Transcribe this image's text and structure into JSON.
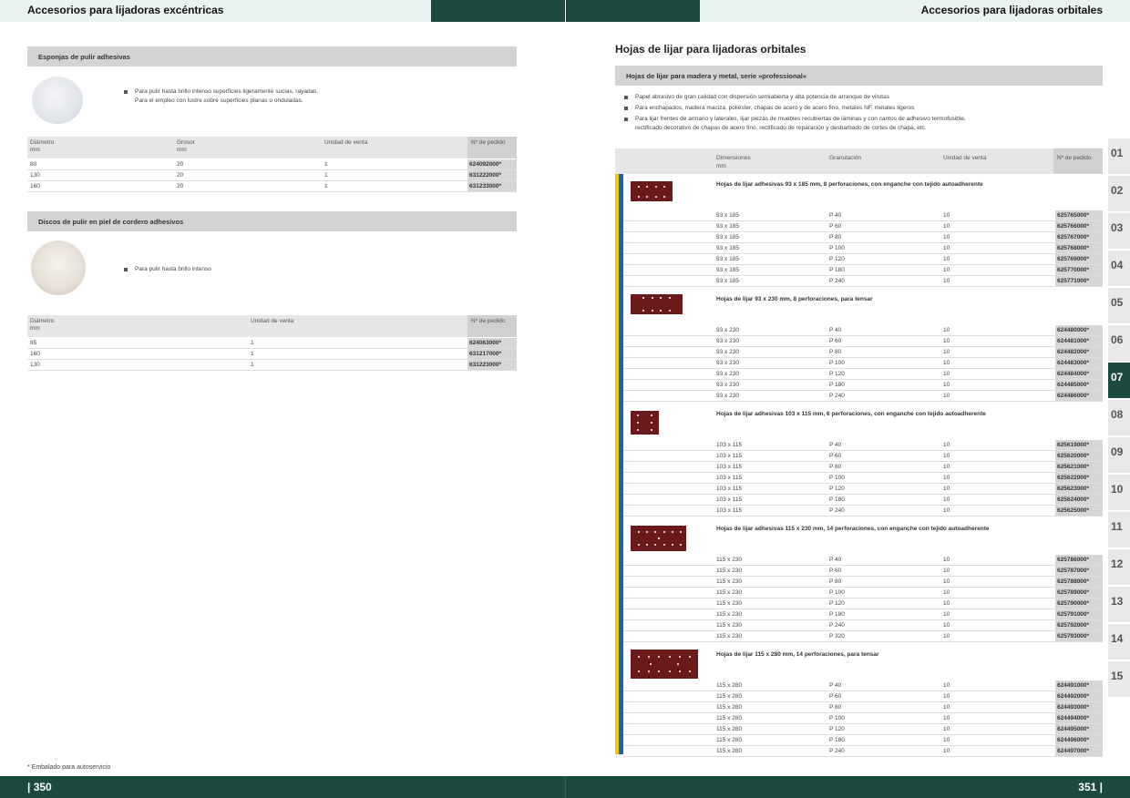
{
  "header": {
    "left_title": "Accesorios para lijadoras excéntricas",
    "right_title": "Accesorios para lijadoras orbitales",
    "colors": {
      "light": "#e9f4f2",
      "dark": "#1b4b3f"
    }
  },
  "footer": {
    "left_page": "| 350",
    "right_page": "351 |",
    "footnote": "* Embalado para autoservicio"
  },
  "left": {
    "sponges": {
      "title": "Esponjas de pulir adhesivas",
      "bullet1_line1": "Para pulir hasta brillo intenso superficies ligeramente sucias, rayadas.",
      "bullet1_line2": "Para el empleo con lustre sobre superficies planas u onduladas.",
      "headers": {
        "diam": "Diámetro",
        "diam_unit": "mm",
        "grosor": "Grosor",
        "grosor_unit": "mm",
        "unidad": "Unidad de venta",
        "pedido": "Nº de pedido"
      },
      "rows": [
        {
          "diam": "80",
          "grosor": "20",
          "unidad": "1",
          "pedido": "624092000*"
        },
        {
          "diam": "130",
          "grosor": "20",
          "unidad": "1",
          "pedido": "631222000*"
        },
        {
          "diam": "160",
          "grosor": "20",
          "unidad": "1",
          "pedido": "631233000*"
        }
      ]
    },
    "lambswool": {
      "title": "Discos de pulir en piel de cordero adhesivos",
      "bullet1": "Para pulir hasta brillo intenso",
      "headers": {
        "diam": "Diámetro",
        "diam_unit": "mm",
        "unidad": "Unidad de venta",
        "pedido": "Nº de pedido"
      },
      "rows": [
        {
          "diam": "85",
          "unidad": "1",
          "pedido": "624063000*"
        },
        {
          "diam": "160",
          "unidad": "1",
          "pedido": "631217000*"
        },
        {
          "diam": "130",
          "unidad": "1",
          "pedido": "631223000*"
        }
      ]
    }
  },
  "right": {
    "title": "Hojas de lijar para lijadoras orbitales",
    "section_title": "Hojas de lijar para madera y metal, serie »professional«",
    "bullets": [
      "Papel abrasivo de gran calidad con dispersión semiabierta y alta potencia de arranque de virutas",
      "Para enchapados, madera maciza, poliéster, chapas de acero y de acero fino, metales NF, metales ligeros",
      "Para lijar frentes de armario y laterales, lijar piezas de muebles recubiertas de láminas y con cantos de adhesivo termofusible,"
    ],
    "bullet3_cont": "rectificado decorativo de chapas de acero fino, rectificado de reparación y desbarbado de cortes de chapa, etc.",
    "headers": {
      "dim": "Dimensiones",
      "dim_unit": "mm",
      "gran": "Granulación",
      "unidad": "Unidad de venta",
      "pedido": "Nº de pedido"
    },
    "groups": [
      {
        "title": "Hojas de lijar adhesivas 93 x 185 mm, 8 perforaciones, con enganche con tejido autoadherente",
        "rows": [
          {
            "dim": "93 x 185",
            "gran": "P 40",
            "unidad": "10",
            "pedido": "625765000*"
          },
          {
            "dim": "93 x 185",
            "gran": "P 60",
            "unidad": "10",
            "pedido": "625766000*"
          },
          {
            "dim": "93 x 185",
            "gran": "P 80",
            "unidad": "10",
            "pedido": "625767000*"
          },
          {
            "dim": "93 x 185",
            "gran": "P 100",
            "unidad": "10",
            "pedido": "625768000*"
          },
          {
            "dim": "93 x 185",
            "gran": "P 120",
            "unidad": "10",
            "pedido": "625769000*"
          },
          {
            "dim": "93 x 185",
            "gran": "P 180",
            "unidad": "10",
            "pedido": "625770000*"
          },
          {
            "dim": "93 x 185",
            "gran": "P 240",
            "unidad": "10",
            "pedido": "625771000*"
          }
        ]
      },
      {
        "title": "Hojas de lijar 93 x 230 mm, 8 perforaciones, para tensar",
        "rows": [
          {
            "dim": "93 x 230",
            "gran": "P 40",
            "unidad": "10",
            "pedido": "624480000*"
          },
          {
            "dim": "93 x 230",
            "gran": "P 60",
            "unidad": "10",
            "pedido": "624481000*"
          },
          {
            "dim": "93 x 230",
            "gran": "P 80",
            "unidad": "10",
            "pedido": "624482000*"
          },
          {
            "dim": "93 x 230",
            "gran": "P 100",
            "unidad": "10",
            "pedido": "624483000*"
          },
          {
            "dim": "93 x 230",
            "gran": "P 120",
            "unidad": "10",
            "pedido": "624484000*"
          },
          {
            "dim": "93 x 230",
            "gran": "P 180",
            "unidad": "10",
            "pedido": "624485000*"
          },
          {
            "dim": "93 x 230",
            "gran": "P 240",
            "unidad": "10",
            "pedido": "624486000*"
          }
        ]
      },
      {
        "title": "Hojas de lijar adhesivas 103 x 115 mm, 6 perforaciones, con enganche con tejido autoadherente",
        "rows": [
          {
            "dim": "103 x 115",
            "gran": "P 40",
            "unidad": "10",
            "pedido": "625619000*"
          },
          {
            "dim": "103 x 115",
            "gran": "P 60",
            "unidad": "10",
            "pedido": "625620000*"
          },
          {
            "dim": "103 x 115",
            "gran": "P 80",
            "unidad": "10",
            "pedido": "625621000*"
          },
          {
            "dim": "103 x 115",
            "gran": "P 100",
            "unidad": "10",
            "pedido": "625622000*"
          },
          {
            "dim": "103 x 115",
            "gran": "P 120",
            "unidad": "10",
            "pedido": "625623000*"
          },
          {
            "dim": "103 x 115",
            "gran": "P 180",
            "unidad": "10",
            "pedido": "625624000*"
          },
          {
            "dim": "103 x 115",
            "gran": "P 240",
            "unidad": "10",
            "pedido": "625625000*"
          }
        ]
      },
      {
        "title": "Hojas de lijar adhesivas 115 x 230 mm, 14 perforaciones, con enganche con tejido autoadherente",
        "rows": [
          {
            "dim": "115 x 230",
            "gran": "P 40",
            "unidad": "10",
            "pedido": "625786000*"
          },
          {
            "dim": "115 x 230",
            "gran": "P 60",
            "unidad": "10",
            "pedido": "625787000*"
          },
          {
            "dim": "115 x 230",
            "gran": "P 80",
            "unidad": "10",
            "pedido": "625788000*"
          },
          {
            "dim": "115 x 230",
            "gran": "P 100",
            "unidad": "10",
            "pedido": "625789000*"
          },
          {
            "dim": "115 x 230",
            "gran": "P 120",
            "unidad": "10",
            "pedido": "625790000*"
          },
          {
            "dim": "115 x 230",
            "gran": "P 180",
            "unidad": "10",
            "pedido": "625791000*"
          },
          {
            "dim": "115 x 230",
            "gran": "P 240",
            "unidad": "10",
            "pedido": "625792000*"
          },
          {
            "dim": "115 x 230",
            "gran": "P 320",
            "unidad": "10",
            "pedido": "625793000*"
          }
        ]
      },
      {
        "title": "Hojas de lijar 115 x 280 mm, 14 perforaciones, para tensar",
        "rows": [
          {
            "dim": "115 x 280",
            "gran": "P 40",
            "unidad": "10",
            "pedido": "624491000*"
          },
          {
            "dim": "115 x 280",
            "gran": "P 60",
            "unidad": "10",
            "pedido": "624492000*"
          },
          {
            "dim": "115 x 280",
            "gran": "P 80",
            "unidad": "10",
            "pedido": "624493000*"
          },
          {
            "dim": "115 x 280",
            "gran": "P 100",
            "unidad": "10",
            "pedido": "624494000*"
          },
          {
            "dim": "115 x 280",
            "gran": "P 120",
            "unidad": "10",
            "pedido": "624495000*"
          },
          {
            "dim": "115 x 280",
            "gran": "P 180",
            "unidad": "10",
            "pedido": "624496000*"
          },
          {
            "dim": "115 x 280",
            "gran": "P 240",
            "unidad": "10",
            "pedido": "624497000*"
          }
        ]
      }
    ]
  },
  "tabs": [
    "01",
    "02",
    "03",
    "04",
    "05",
    "06",
    "07",
    "08",
    "09",
    "10",
    "11",
    "12",
    "13",
    "14",
    "15"
  ],
  "active_tab": "07"
}
